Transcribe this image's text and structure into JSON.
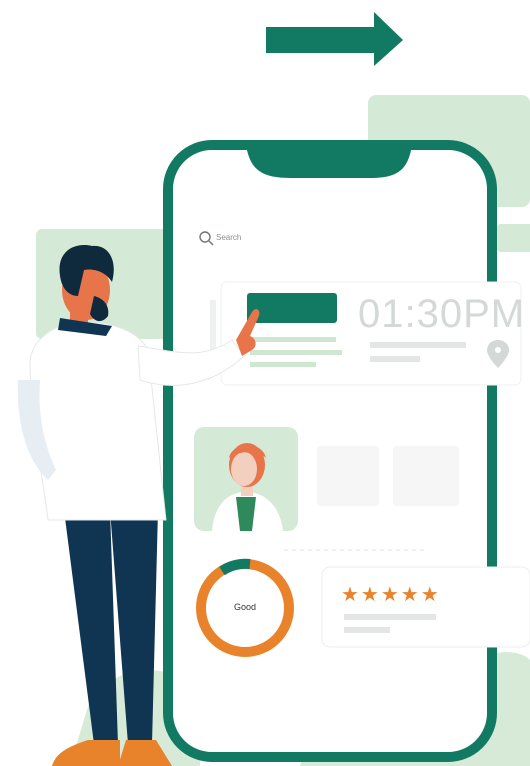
{
  "search": {
    "label": "Search"
  },
  "appointment": {
    "time": "01:30PM"
  },
  "rating": {
    "stars": "★★★★★",
    "value": 5,
    "max": 5
  },
  "gauge": {
    "label": "Good"
  },
  "colors": {
    "primary": "#127a63",
    "pale_green": "#cfe6d0",
    "orange": "#e8832c",
    "navy": "#0f3552"
  },
  "icons": [
    "arrow-right-icon",
    "search-icon",
    "location-pin-icon",
    "star-icon"
  ]
}
